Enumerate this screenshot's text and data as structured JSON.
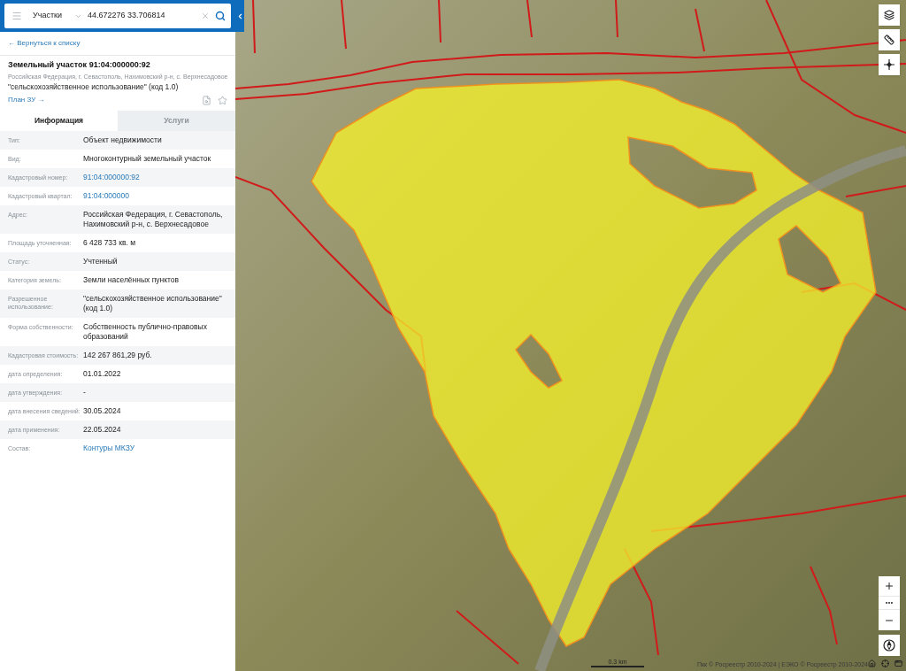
{
  "search": {
    "category": "Участки",
    "value": "44.672276 33.706814"
  },
  "back_link": "← Вернуться к списку",
  "parcel": {
    "title": "Земельный участок 91:04:000000:92",
    "address": "Российская Федерация, г. Севастополь, Нахимовский р-н, с. Верхнесадовое",
    "use": "\"сельскохозяйственное использование\" (код 1.0)",
    "plan_link": "План ЗУ →"
  },
  "tabs": [
    {
      "label": "Информация",
      "selected": true
    },
    {
      "label": "Услуги",
      "selected": false
    }
  ],
  "properties": [
    {
      "label": "Тип:",
      "value": "Объект недвижимости",
      "kind": "text"
    },
    {
      "label": "Вид:",
      "value": "Многоконтурный земельный участок",
      "kind": "text"
    },
    {
      "label": "Кадастровый номер:",
      "value": "91:04:000000:92",
      "kind": "link"
    },
    {
      "label": "Кадастровый квартал:",
      "value": "91:04:000000",
      "kind": "link"
    },
    {
      "label": "Адрес:",
      "value": "Российская Федерация, г. Севастополь, Нахимовский р-н, с. Верхнесадовое",
      "kind": "text"
    },
    {
      "label": "Площадь уточненная:",
      "value": "6 428 733 кв. м",
      "kind": "text"
    },
    {
      "label": "Статус:",
      "value": "Учтенный",
      "kind": "text"
    },
    {
      "label": "Категория земель:",
      "value": "Земли населённых пунктов",
      "kind": "text"
    },
    {
      "label": "Разрешенное использование:",
      "value": "\"сельскохозяйственное использование\" (код 1.0)",
      "kind": "text"
    },
    {
      "label": "Форма собственности:",
      "value": "Собственность публично-правовых образований",
      "kind": "text"
    },
    {
      "label": "Кадастровая стоимость:",
      "value": "142 267 861,29 руб.",
      "kind": "text"
    },
    {
      "label": "дата определения:",
      "value": "01.01.2022",
      "kind": "text"
    },
    {
      "label": "дата утверждения:",
      "value": "-",
      "kind": "text"
    },
    {
      "label": "дата внесения сведений:",
      "value": "30.05.2024",
      "kind": "text"
    },
    {
      "label": "дата применения:",
      "value": "22.05.2024",
      "kind": "text"
    },
    {
      "label": "Состав:",
      "value": "Контуры МКЗУ",
      "kind": "link"
    }
  ],
  "map": {
    "scale": "0.3 km",
    "attribution": "Пкк © Росреестр 2010-2024 | ЕЭКО © Росреестр 2010-2024"
  }
}
